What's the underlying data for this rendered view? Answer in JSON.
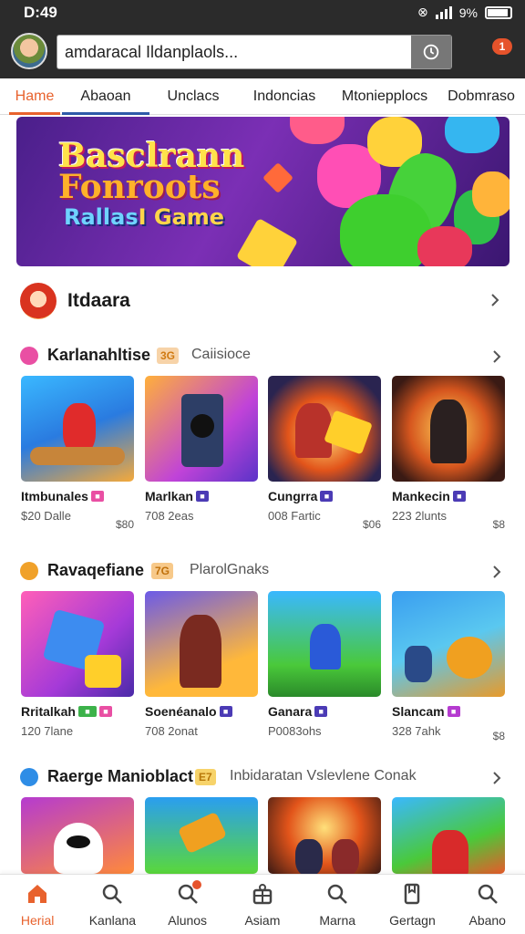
{
  "status": {
    "time": "D:49",
    "battery": "9%"
  },
  "header": {
    "search_value": "amdaracal Ildanplaols...",
    "notif_badge": "1"
  },
  "tabs": [
    {
      "label": "Hame",
      "active": true
    },
    {
      "label": "Abaoan"
    },
    {
      "label": "Unclacs"
    },
    {
      "label": "Indoncias"
    },
    {
      "label": "Mtoniepplocs"
    },
    {
      "label": "Dobmraso"
    }
  ],
  "banner": {
    "line1": "Basclrann",
    "line2": "Fonroots",
    "line3a": "Rallas",
    "line3b": "I Game"
  },
  "profile": {
    "name": "Itdaara"
  },
  "sections": [
    {
      "title": "Karlanahltise",
      "tag": "3G",
      "sub": "Caiisioce",
      "icon_color": "#e94fa3",
      "cards": [
        {
          "name": "Itmbunales",
          "meta": "$20 Dalle",
          "price": "$80"
        },
        {
          "name": "Marlkan",
          "meta": "708 2eas",
          "price": ""
        },
        {
          "name": "Cungrra",
          "meta": "008 Fartic",
          "price": "$06"
        },
        {
          "name": "Mankecin",
          "meta": "223 2lunts",
          "price": "$8"
        }
      ]
    },
    {
      "title": "Ravaqefiane",
      "tag": "7G",
      "sub": "PlarolGnaks",
      "icon_color": "#f0a12a",
      "cards": [
        {
          "name": "Rritalkah",
          "meta": "120 7lane",
          "price": ""
        },
        {
          "name": "Soenéanalo",
          "meta": "708 2onat",
          "price": ""
        },
        {
          "name": "Ganara",
          "meta": "P0083ohs",
          "price": ""
        },
        {
          "name": "Slancam",
          "meta": "328 7ahk",
          "price": "$8"
        }
      ]
    },
    {
      "title": "Raerge Manioblact",
      "tag": "E7",
      "sub": "Inbidaratan  Vslevlene Conak",
      "icon_color": "#2e8de6",
      "cards": [
        {
          "name": "",
          "meta": "",
          "price": ""
        },
        {
          "name": "",
          "meta": "",
          "price": ""
        },
        {
          "name": "",
          "meta": "",
          "price": ""
        },
        {
          "name": "",
          "meta": "",
          "price": ""
        }
      ]
    }
  ],
  "bottom_nav": [
    {
      "label": "Herial",
      "icon": "home-icon",
      "active": true
    },
    {
      "label": "Kanlana",
      "icon": "search-icon"
    },
    {
      "label": "Alunos",
      "icon": "users-icon"
    },
    {
      "label": "Asiam",
      "icon": "gift-icon"
    },
    {
      "label": "Marna",
      "icon": "search-icon"
    },
    {
      "label": "Gertagn",
      "icon": "bookmark-icon"
    },
    {
      "label": "Abano",
      "icon": "search-icon"
    }
  ],
  "colors": {
    "accent": "#e8622d",
    "header_bg": "#2b2b2b"
  }
}
